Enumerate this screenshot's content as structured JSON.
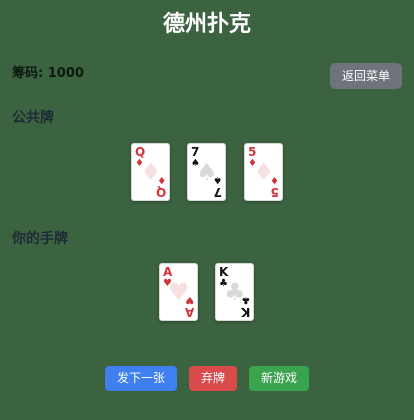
{
  "title": "德州扑克",
  "chips_label": "筹码: 1000",
  "menu_button": "返回菜单",
  "community": {
    "label": "公共牌",
    "cards": [
      {
        "rank": "Q",
        "suit": "♦",
        "color": "red"
      },
      {
        "rank": "7",
        "suit": "♠",
        "color": "black"
      },
      {
        "rank": "5",
        "suit": "♦",
        "color": "red"
      }
    ]
  },
  "hand": {
    "label": "你的手牌",
    "cards": [
      {
        "rank": "A",
        "suit": "♥",
        "color": "red"
      },
      {
        "rank": "K",
        "suit": "♣",
        "color": "black"
      }
    ]
  },
  "buttons": {
    "deal": "发下一张",
    "fold": "弃牌",
    "new_game": "新游戏"
  },
  "colors": {
    "table": "#3c6340",
    "menu_button": "#6e737c",
    "deal_button": "#3f7ff0",
    "fold_button": "#d94b4b",
    "new_game_button": "#3aa34e",
    "red_suit": "#d1353a",
    "black_suit": "#111111"
  }
}
